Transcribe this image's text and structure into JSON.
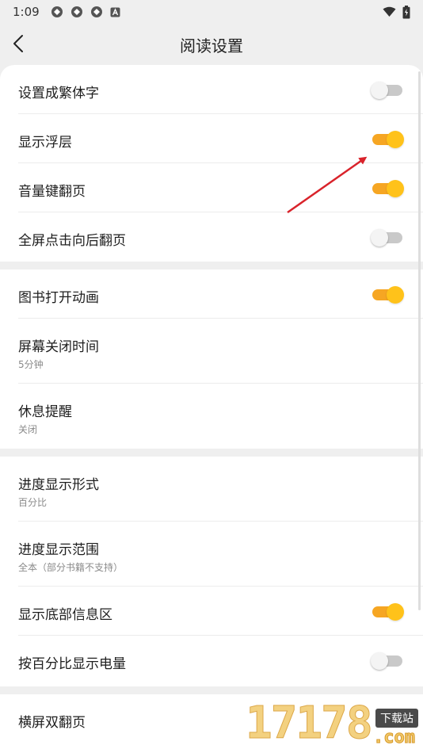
{
  "status_bar": {
    "time": "1:09"
  },
  "nav": {
    "title": "阅读设置"
  },
  "sections": [
    {
      "items": [
        {
          "label": "设置成繁体字",
          "toggle": false
        },
        {
          "label": "显示浮层",
          "toggle": true
        },
        {
          "label": "音量键翻页",
          "toggle": true
        },
        {
          "label": "全屏点击向后翻页",
          "toggle": false
        }
      ]
    },
    {
      "items": [
        {
          "label": "图书打开动画",
          "toggle": true
        },
        {
          "label": "屏幕关闭时间",
          "value": "5分钟"
        },
        {
          "label": "休息提醒",
          "value": "关闭"
        }
      ]
    },
    {
      "items": [
        {
          "label": "进度显示形式",
          "value": "百分比"
        },
        {
          "label": "进度显示范围",
          "value": "全本（部分书籍不支持）"
        },
        {
          "label": "显示底部信息区",
          "toggle": true
        },
        {
          "label": "按百分比显示电量",
          "toggle": false
        }
      ]
    },
    {
      "items": [
        {
          "label": "横屏双翻页"
        }
      ]
    }
  ],
  "watermark": {
    "number": "17178",
    "tag": "下载站",
    "suffix": ".com"
  },
  "colors": {
    "accent": "#f6a623",
    "knob_on": "#ffc21a",
    "arrow": "#d9232b"
  }
}
